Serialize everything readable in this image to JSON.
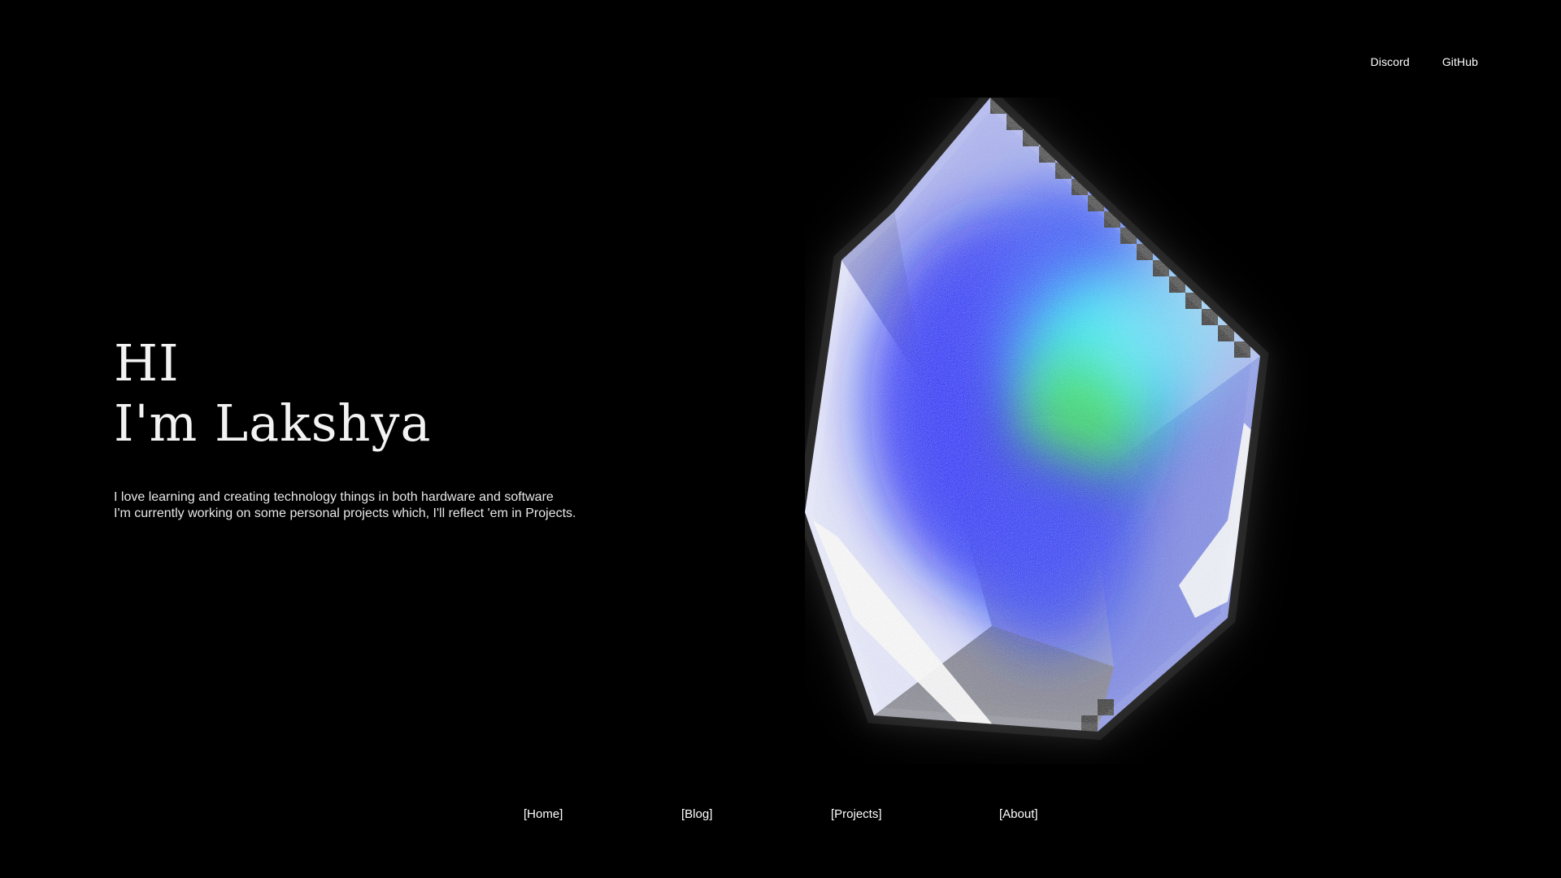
{
  "header": {
    "links": [
      {
        "label": "Discord"
      },
      {
        "label": "GitHub"
      }
    ]
  },
  "hero": {
    "greeting": "HI",
    "name_line": "I'm Lakshya",
    "intro_lines": [
      "I love learning and creating technology things in both hardware and software",
      "I'm currently working on some personal projects which, I'll reflect 'em in Projects."
    ]
  },
  "artwork": {
    "description_icon": "pixelated-glowing-cube-icon",
    "colors": {
      "edge": "#ffffff",
      "blue": "#0a1cff",
      "cyan": "#00f0ff",
      "green": "#19e25a",
      "lavender": "#8b93f0",
      "grey": "#7a7a86"
    }
  },
  "bottom_nav": {
    "items": [
      {
        "label": "[Home]"
      },
      {
        "label": "[Blog]"
      },
      {
        "label": "[Projects]"
      },
      {
        "label": "[About]"
      }
    ]
  }
}
